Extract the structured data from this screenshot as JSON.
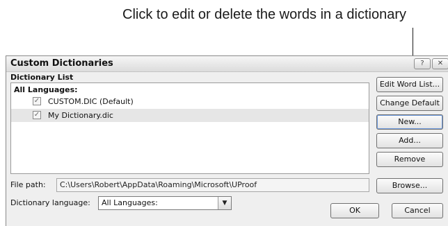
{
  "callout": {
    "text": "Click to edit or delete the words in a dictionary"
  },
  "dialog": {
    "title": "Custom Dictionaries",
    "help_glyph": "?",
    "close_glyph": "✕",
    "list_label": "Dictionary List",
    "group_heading": "All Languages:",
    "items": [
      {
        "label": "CUSTOM.DIC (Default)",
        "checked": true,
        "selected": false
      },
      {
        "label": "My Dictionary.dic",
        "checked": true,
        "selected": true
      }
    ],
    "buttons": {
      "edit": "Edit Word List...",
      "change_default": "Change Default",
      "new": "New...",
      "add": "Add...",
      "remove": "Remove",
      "browse": "Browse...",
      "ok": "OK",
      "cancel": "Cancel"
    },
    "file_path_label": "File path:",
    "file_path_value": "C:\\Users\\Robert\\AppData\\Roaming\\Microsoft\\UProof",
    "language_label": "Dictionary language:",
    "language_value": "All Languages:",
    "check_glyph": "✓"
  }
}
